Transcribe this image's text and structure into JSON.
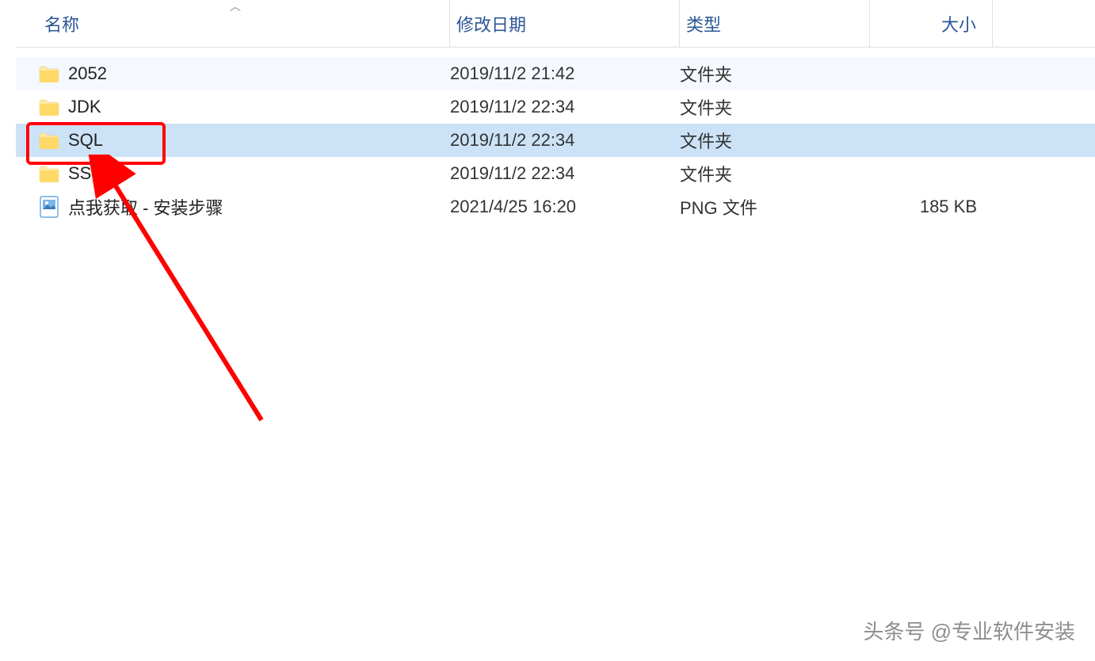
{
  "columns": {
    "name": "名称",
    "date": "修改日期",
    "type": "类型",
    "size": "大小"
  },
  "files": [
    {
      "name": "2052",
      "date": "2019/11/2 21:42",
      "type": "文件夹",
      "size": "",
      "icon": "folder",
      "alt": true,
      "selected": false,
      "highlighted": false
    },
    {
      "name": "JDK",
      "date": "2019/11/2 22:34",
      "type": "文件夹",
      "size": "",
      "icon": "folder",
      "alt": false,
      "selected": false,
      "highlighted": false
    },
    {
      "name": "SQL",
      "date": "2019/11/2 22:34",
      "type": "文件夹",
      "size": "",
      "icon": "folder",
      "alt": false,
      "selected": true,
      "highlighted": true
    },
    {
      "name": "SSMS",
      "date": "2019/11/2 22:34",
      "type": "文件夹",
      "size": "",
      "icon": "folder",
      "alt": false,
      "selected": false,
      "highlighted": false
    },
    {
      "name": "点我获取 - 安装步骤",
      "date": "2021/4/25 16:20",
      "type": "PNG 文件",
      "size": "185 KB",
      "icon": "png",
      "alt": false,
      "selected": false,
      "highlighted": false
    }
  ],
  "watermark": "头条号 @专业软件安装"
}
